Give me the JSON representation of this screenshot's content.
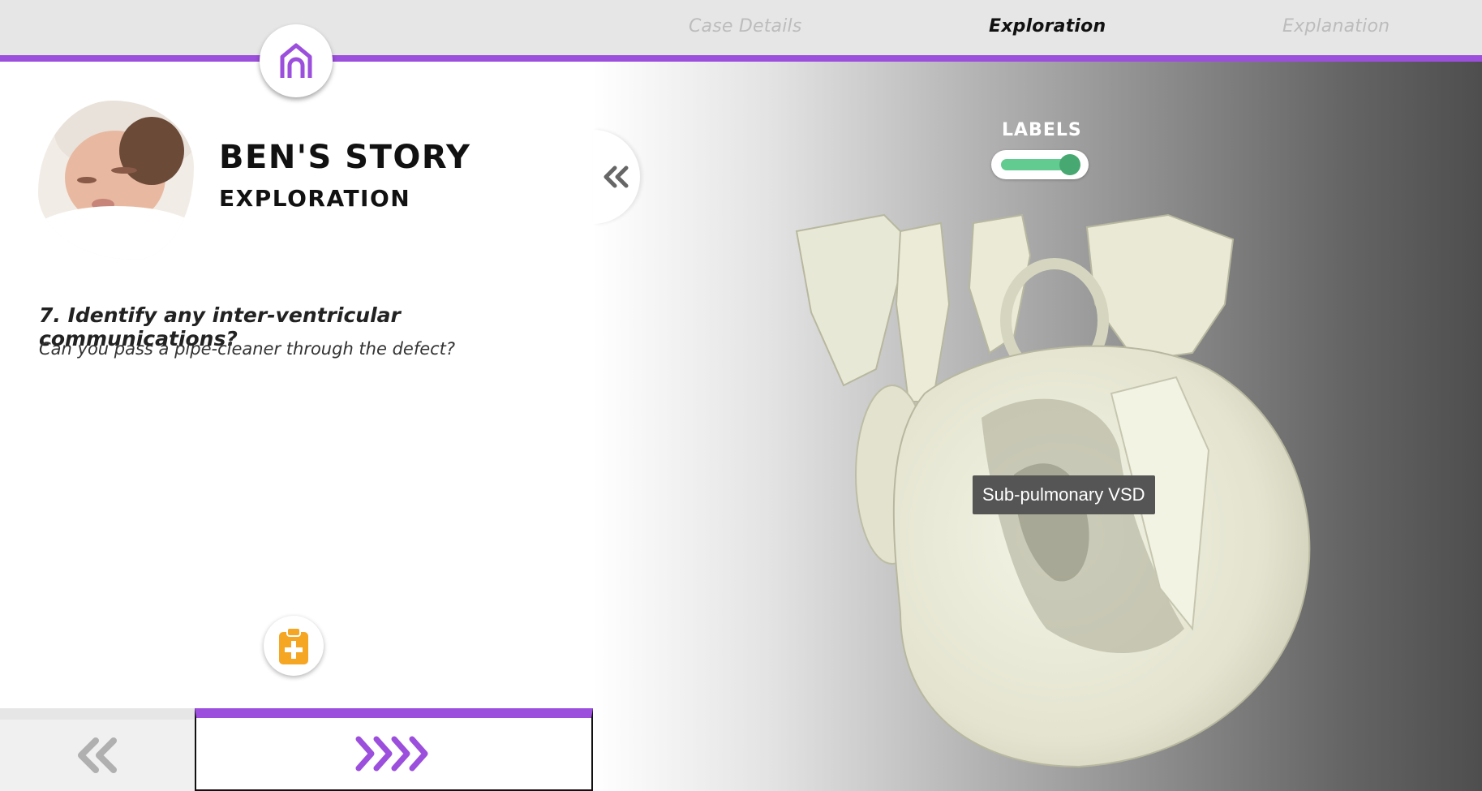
{
  "tabs": {
    "case_details": "Case Details",
    "exploration": "Exploration",
    "explanation": "Explanation"
  },
  "story": {
    "title": "BEN'S STORY",
    "subtitle": "EXPLORATION"
  },
  "question": {
    "text": "7. Identify any inter-ventricular communications?",
    "hint": "Can you pass a pipe-cleaner through the defect?"
  },
  "viewer": {
    "labels_title": "LABELS",
    "labels_enabled": true,
    "annotation": "Sub-pulmonary VSD"
  },
  "colors": {
    "accent": "#9b4fdc",
    "toggle": "#62cb90",
    "clipboard": "#f5a623"
  },
  "icons": {
    "home": "home-icon",
    "collapse": "double-chevron-left-icon",
    "clipboard": "clipboard-medical-icon",
    "prev": "double-chevron-left-icon",
    "next": "quad-chevron-right-icon"
  }
}
